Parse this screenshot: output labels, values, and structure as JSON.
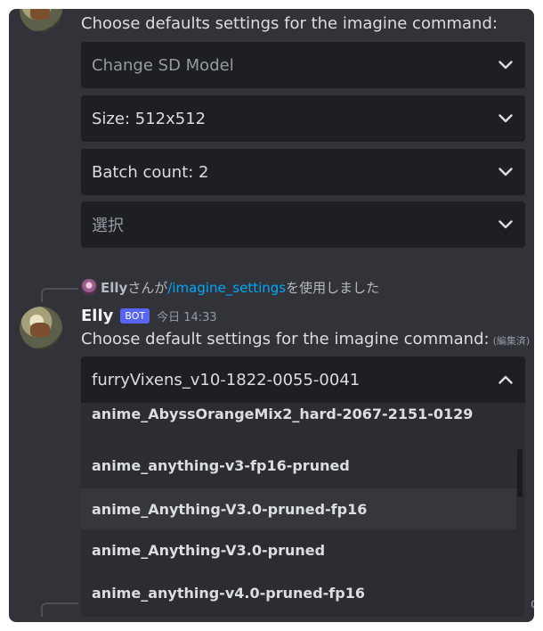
{
  "first_message": {
    "text": "Choose defaults settings for the imagine command:",
    "selects": [
      {
        "value": "Change SD Model",
        "state": "placeholder"
      },
      {
        "value": "Size: 512x512",
        "state": "filled"
      },
      {
        "value": "Batch count: 2",
        "state": "filled"
      },
      {
        "value": "選択",
        "state": "placeholder"
      }
    ]
  },
  "reply": {
    "username": "Elly",
    "pre_text": "さんが",
    "command": "/imagine_settings",
    "post_text": "を使用しました"
  },
  "second_message": {
    "author": "Elly",
    "bot_tag": "BOT",
    "timestamp": "今日 14:33",
    "text": "Choose default settings for the imagine command:",
    "edited": "(編集済)",
    "selected_value": "furryVixens_v10-1822-0055-0041",
    "options": [
      "anime_AbyssOrangeMix2_hard-2067-2151-0129",
      "anime_anything-v3-fp16-pruned",
      "anime_Anything-V3.0-pruned-fp16",
      "anime_Anything-V3.0-pruned",
      "anime_anything-v4.0-pruned-fp16"
    ],
    "hovered_option_index": 2
  },
  "peek_char": "d",
  "icons": {
    "chevron_down": "chevron-down-icon",
    "chevron_up": "chevron-up-icon"
  },
  "colors": {
    "background": "#313338",
    "select_bg": "#1e1f22",
    "dropdown_bg": "#2b2d31",
    "link": "#00a8fc",
    "bot_tag": "#5865f2"
  }
}
